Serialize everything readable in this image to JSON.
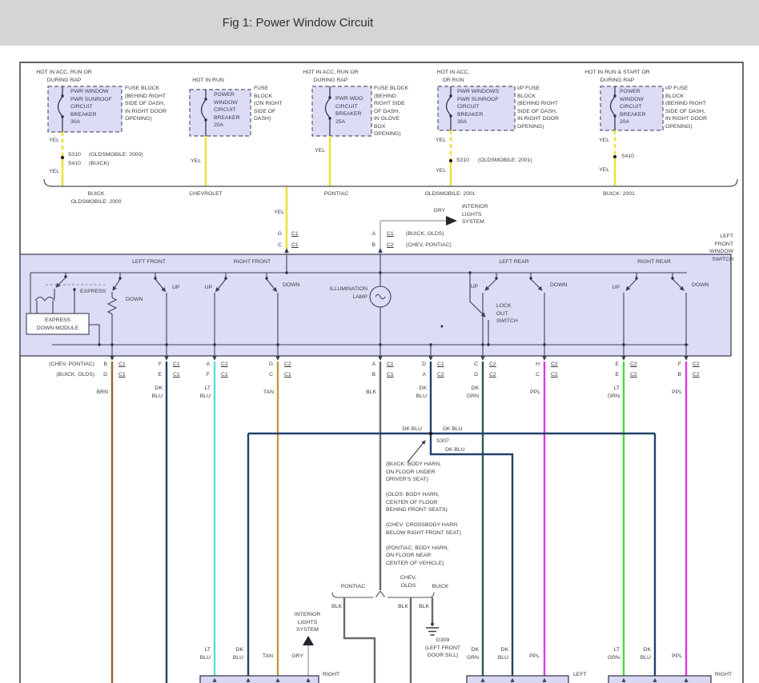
{
  "title": "Fig 1: Power Window Circuit",
  "colors": {
    "yel": "#efe13e",
    "brn": "#8a6b2a",
    "dk_blu": "#23406b",
    "lt_blu": "#55dce8",
    "tan": "#bf9a45",
    "blk": "#6a6a6a",
    "dk_grn": "#2b5a4e",
    "lt_grn": "#46d93e",
    "ppl": "#e03ae0",
    "gry": "#c2c2c2"
  },
  "feeds": [
    {
      "header": "HOT IN ACC, RUN OR\nDURING RAP",
      "breaker": "PWR WINDOW\nPWR SUNROOF\nCIRCUIT\nBREAKER\n30A",
      "location": "FUSE BLOCK\n(BEHIND RIGHT\nSIDE OF DASH,\nIN RIGHT DOOR\nOPENING)",
      "wire_label_1": "YEL",
      "splice": "S310",
      "splice_note": "(OLDSMOBILE: 2000)",
      "splice_2": "S410",
      "splice_note_2": "(BUICK)",
      "wire_label_2": "YEL",
      "brand": "BUICK\nOLDSMOBILE: 2000"
    },
    {
      "header": "HOT IN RUN",
      "breaker": "POWER\nWINDOW\nCIRCUIT\nBREAKER\n20A",
      "location": "FUSE\nBLOCK\n(ON RIGHT\nSIDE OF\nDASH)",
      "wire_label_1": "YEL",
      "brand": "CHEVROLET"
    },
    {
      "header": "HOT IN ACC, RUN OR\nDURING RAP",
      "breaker": "PWR WDO\nCIRCUIT\nBREAKER\n25A",
      "location": "FUSE BLOCK\n(BEHIND\nRIGHT SIDE\nOF DASH,\nIN GLOVE\nBOX\nOPENING)",
      "wire_label_1": "YEL",
      "brand": "PONTIAC"
    },
    {
      "header": "HOT IN ACC,\nOR RUN",
      "breaker": "PWR WINDOWS\nPWR SUNROOF\nCIRCUIT\nBREAKER\n30A",
      "location": "I/P FUSE\nBLOCK\n(BEHIND RIGHT\nSIDE OF DASH,\nIN RIGHT DOOR\nOPENING)",
      "wire_label_1": "YEL",
      "splice": "S310",
      "splice_note": "(OLDSMOBILE: 2001)",
      "wire_label_2": "YEL",
      "brand": "OLDSMOBILE: 2001"
    },
    {
      "header": "HOT IN RUN & START OR\nDURING RAP",
      "breaker": "POWER\nWINDOW\nCIRCUIT\nBREAKER\n20A",
      "location": "I/P FUSE\nBLOCK\n(BEHIND RIGHT\nSIDE OF DASH,\nIN RIGHT DOOR\nOPENING)",
      "wire_label_1": "YEL",
      "splice": "S410",
      "wire_label_2": "YEL",
      "brand": "BUICK: 2001"
    }
  ],
  "trunk": {
    "wire_label": "YEL",
    "pin_1": "G",
    "conn_1": "C1",
    "pin_2": "C",
    "conn_2": "C1"
  },
  "gry_branch": {
    "wire_label": "GRY",
    "target": "INTERIOR\nLIGHTS\nSYSTEM",
    "pin_1": "A",
    "conn_1": "C1",
    "note_1": "(BUICK, OLDS)",
    "pin_2": "B",
    "conn_2": "C2",
    "note_2": "(CHEV, PONTIAC)"
  },
  "switch": {
    "title": "LEFT FRONT\nWINDOW SWITCH",
    "sections": [
      {
        "label": "LEFT FRONT"
      },
      {
        "label": "RIGHT FRONT"
      },
      {
        "label": "LEFT REAR"
      },
      {
        "label": "RIGHT REAR"
      }
    ],
    "express": "EXPRESS",
    "express_module": "EXPRESS\nDOWN MODULE",
    "lamp": "ILLUMINATION\nLAMP",
    "lockout": "LOCK\nOUT\nSWITCH",
    "up": "UP",
    "down": "DOWN"
  },
  "pin_rows": {
    "caption_1": "(CHEV, PONTIAC)",
    "caption_2": "(BUICK, OLDS)",
    "pins": [
      {
        "p1": "B",
        "c1": "C1",
        "p2": "D",
        "c2": "C1",
        "color": "BRN"
      },
      {
        "p1": "F",
        "c1": "C1",
        "p2": "E",
        "c2": "C1",
        "color": "DK\nBLU"
      },
      {
        "p1": "A",
        "c1": "C2",
        "p2": "F",
        "c2": "C1",
        "color": "LT\nBLU"
      },
      {
        "p1": "G",
        "c1": "C2",
        "p2": "C",
        "c2": "C1",
        "color": "TAN"
      },
      {
        "p1": "A",
        "c1": "C1",
        "p2": "B",
        "c2": "C1",
        "color": "BLK"
      },
      {
        "p1": "D",
        "c1": "C1",
        "p2": "A",
        "c2": "C2",
        "color": "DK\nBLU"
      },
      {
        "p1": "C",
        "c1": "C2",
        "p2": "D",
        "c2": "C2",
        "color": "DK\nGRN"
      },
      {
        "p1": "H",
        "c1": "C2",
        "p2": "C",
        "c2": "C2",
        "color": "PPL"
      },
      {
        "p1": "E",
        "c1": "C2",
        "p2": "E",
        "c2": "C2",
        "color": "LT\nGRN"
      },
      {
        "p1": "F",
        "c1": "C2",
        "p2": "B",
        "c2": "C2",
        "color": "PPL"
      }
    ]
  },
  "s307": {
    "name": "S307",
    "label_left": "DK BLU",
    "label_right": "DK BLU",
    "label_down": "DK BLU",
    "notes": "(BUICK: BODY HARN,\nON FLOOR UNDER\nDRIVER'S SEAT)\n\n(OLDS: BODY HARN,\nCENTER OF FLOOR\nBEHIND FRONT SEATS)\n\n(CHEV: CROSSBODY HARN\nBELOW RIGHT FRONT SEAT)\n\n(PONTIAC: BODY HARN,\nON FLOOR NEAR\nCENTER OF VEHICLE)"
  },
  "ground_area": {
    "branch_1": "PONTIAC",
    "branch_2": "CHEV,\nOLDS",
    "branch_3": "BUICK",
    "wire_1": "BLK",
    "wire_2": "BLK",
    "wire_3": "BLK",
    "ground": "G309\n(LEFT FRONT\nDOOR SILL)"
  },
  "bottom": {
    "interior": "INTERIOR\nLIGHTS\nSYSTEM",
    "box_1": "RIGHT",
    "box_2": "LEFT",
    "box_3": "RIGHT",
    "labels": [
      "LT\nBLU",
      "DK\nBLU",
      "TAN",
      "GRY",
      "DK\nGRN",
      "DK\nBLU",
      "PPL",
      "LT\nGRN",
      "DK\nBLU",
      "PPL"
    ]
  }
}
